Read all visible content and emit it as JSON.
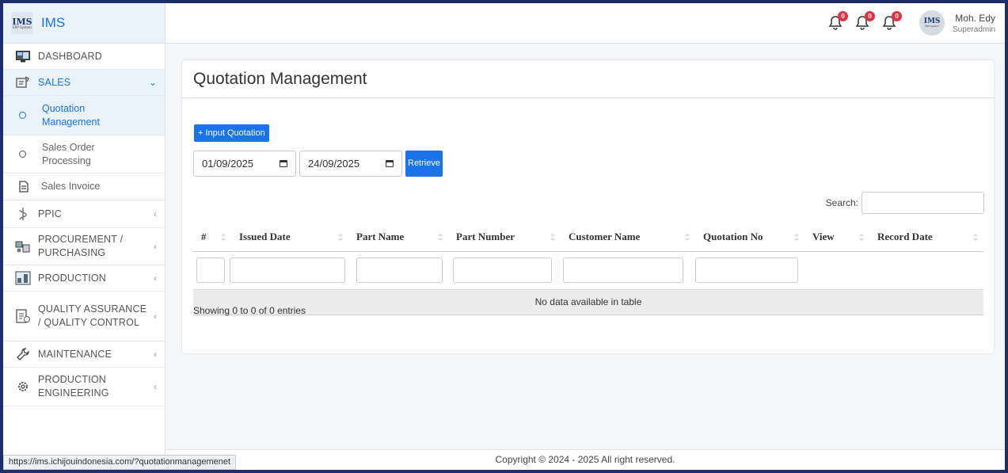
{
  "brand": {
    "logo_text": "IMS",
    "logo_sub": "ERP System",
    "name": "IMS"
  },
  "header": {
    "notifications": [
      {
        "icon": "bell-icon",
        "count": "0"
      },
      {
        "icon": "bell-icon",
        "count": "0"
      },
      {
        "icon": "bell-icon",
        "count": "0"
      }
    ],
    "user": {
      "avatar_text": "IMS",
      "name": "Moh. Edy",
      "role": "Superadmin"
    }
  },
  "sidebar": {
    "items": [
      {
        "label": "DASHBOARD",
        "icon": "dashboard-icon"
      },
      {
        "label": "SALES",
        "icon": "sales-icon",
        "expanded": true,
        "children": [
          {
            "label": "Quotation Management",
            "current": true
          },
          {
            "label": "Sales Order Processing"
          },
          {
            "label": "Sales Invoice",
            "icon": "document-icon"
          }
        ]
      },
      {
        "label": "PPIC",
        "icon": "ppic-icon"
      },
      {
        "label": "PROCUREMENT / PURCHASING",
        "icon": "procurement-icon"
      },
      {
        "label": "PRODUCTION",
        "icon": "production-icon"
      },
      {
        "label": "QUALITY ASSURANCE / QUALITY CONTROL",
        "icon": "quality-icon"
      },
      {
        "label": "MAINTENANCE",
        "icon": "wrench-icon"
      },
      {
        "label": "PRODUCTION ENGINEERING",
        "icon": "gear-icon"
      }
    ]
  },
  "main": {
    "title": "Quotation Management",
    "input_button": "+ Input Quotation",
    "date_from": "01/09/2025",
    "date_to": "24/09/2025",
    "retrieve_button": "Retrieve",
    "search_label": "Search:",
    "search_value": "",
    "table": {
      "columns": [
        "#",
        "Issued Date",
        "Part Name",
        "Part Number",
        "Customer Name",
        "Quotation No",
        "View",
        "Record Date"
      ],
      "empty_message": "No data available in table"
    },
    "showing": "Showing 0 to 0 of 0 entries"
  },
  "footer": {
    "copyright": "Copyright © 2024 - 2025 All right reserved."
  },
  "statusbar": {
    "url": "https://ims.ichijouindonesia.com/?quotationmanagemenet"
  },
  "colors": {
    "accent": "#1a73e8",
    "badge": "#dc3545"
  }
}
